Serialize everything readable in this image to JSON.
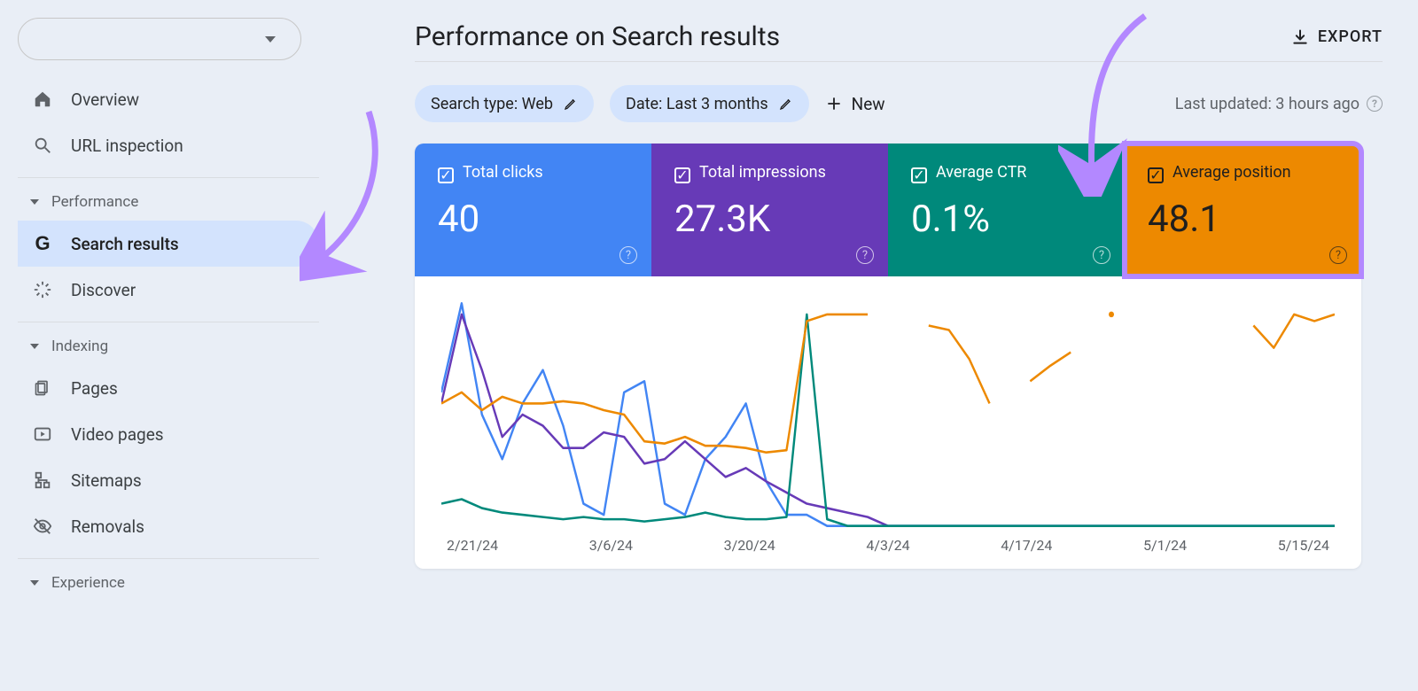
{
  "sidebar": {
    "overview": "Overview",
    "url_inspection": "URL inspection",
    "sections": {
      "performance": "Performance",
      "indexing": "Indexing",
      "experience": "Experience"
    },
    "items": {
      "search_results": "Search results",
      "discover": "Discover",
      "pages": "Pages",
      "video_pages": "Video pages",
      "sitemaps": "Sitemaps",
      "removals": "Removals"
    }
  },
  "header": {
    "title": "Performance on Search results",
    "export": "EXPORT"
  },
  "filters": {
    "search_type": "Search type: Web",
    "date": "Date: Last 3 months",
    "new": "New",
    "last_updated": "Last updated: 3 hours ago"
  },
  "metrics": {
    "clicks": {
      "label": "Total clicks",
      "value": "40"
    },
    "impressions": {
      "label": "Total impressions",
      "value": "27.3K"
    },
    "ctr": {
      "label": "Average CTR",
      "value": "0.1%"
    },
    "position": {
      "label": "Average position",
      "value": "48.1"
    }
  },
  "chart_data": {
    "type": "line",
    "x_ticks": [
      "2/21/24",
      "3/6/24",
      "3/20/24",
      "4/3/24",
      "4/17/24",
      "5/1/24",
      "5/15/24"
    ],
    "notes": "y-axes unlabeled; values are relative percentages of each series' own max",
    "series": [
      {
        "name": "clicks",
        "color": "#4285f4",
        "values": [
          60,
          100,
          50,
          30,
          55,
          70,
          45,
          10,
          5,
          60,
          65,
          10,
          5,
          30,
          40,
          55,
          20,
          5,
          5,
          0,
          0,
          0,
          0,
          0,
          0,
          0,
          0,
          0,
          0,
          0,
          0,
          0,
          0,
          0,
          0,
          0,
          0,
          0,
          0,
          0,
          0,
          0,
          0,
          0,
          0
        ]
      },
      {
        "name": "impressions",
        "color": "#673ab7",
        "values": [
          55,
          95,
          70,
          40,
          50,
          45,
          35,
          35,
          42,
          40,
          28,
          30,
          38,
          30,
          22,
          26,
          20,
          15,
          10,
          8,
          6,
          4,
          0,
          0,
          0,
          0,
          0,
          0,
          0,
          0,
          0,
          0,
          0,
          0,
          0,
          0,
          0,
          0,
          0,
          0,
          0,
          0,
          0,
          0,
          0
        ]
      },
      {
        "name": "ctr",
        "color": "#00897b",
        "values": [
          10,
          12,
          8,
          6,
          5,
          4,
          3,
          4,
          3,
          3,
          2,
          3,
          4,
          6,
          4,
          3,
          3,
          4,
          95,
          3,
          0,
          0,
          0,
          0,
          0,
          0,
          0,
          0,
          0,
          0,
          0,
          0,
          0,
          0,
          0,
          0,
          0,
          0,
          0,
          0,
          0,
          0,
          0,
          0,
          0
        ]
      },
      {
        "name": "position",
        "color": "#ed8900",
        "values": [
          55,
          60,
          52,
          58,
          55,
          55,
          56,
          55,
          52,
          50,
          38,
          37,
          40,
          36,
          36,
          35,
          33,
          34,
          92,
          95,
          95,
          95,
          null,
          null,
          90,
          88,
          75,
          55,
          null,
          65,
          72,
          78,
          null,
          95,
          null,
          null,
          null,
          null,
          null,
          null,
          90,
          80,
          95,
          92,
          95
        ]
      }
    ]
  },
  "colors": {
    "blue": "#4285f4",
    "purple": "#673ab7",
    "teal": "#00897b",
    "orange": "#ed8900",
    "accent_highlight": "#b388ff"
  }
}
